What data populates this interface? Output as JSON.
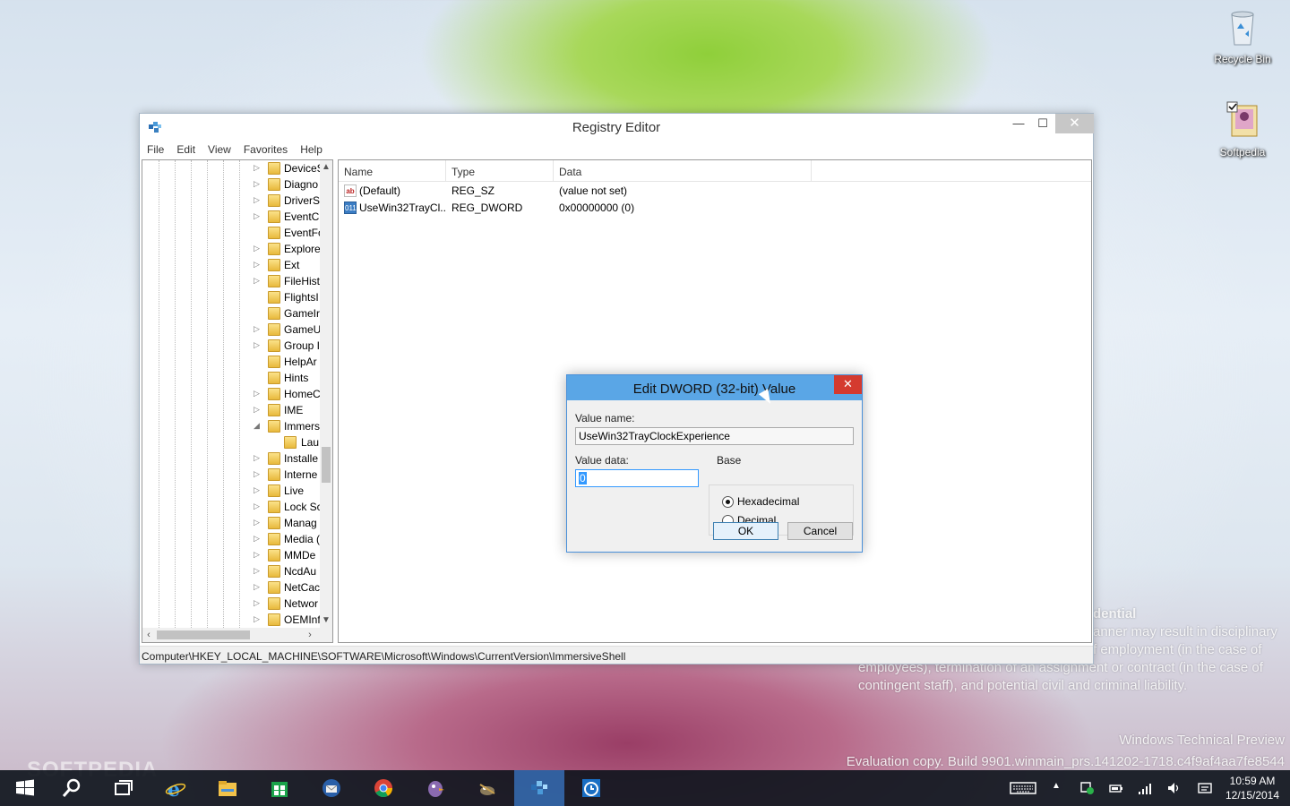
{
  "desktop": {
    "icons": [
      {
        "label": "Recycle Bin"
      },
      {
        "label": "Softpedia"
      }
    ],
    "notice": {
      "heading": "dential",
      "lines": [
        "anner may result in disciplinary",
        "f employment (in the case of",
        "employees), termination of an assignment or contract (in the case of",
        "contingent staff), and potential civil and criminal liability."
      ]
    },
    "build_lines": [
      "Windows Technical Preview",
      "Evaluation copy. Build 9901.winmain_prs.141202-1718.c4f9af4aa7fe8544"
    ],
    "watermark": "SOFTPEDIA"
  },
  "window": {
    "title": "Registry Editor",
    "controls": {
      "minimize": "—",
      "maximize": "☐",
      "close": "✕"
    },
    "menu": [
      "File",
      "Edit",
      "View",
      "Favorites",
      "Help"
    ],
    "tree": {
      "items": [
        {
          "label": "DeviceS",
          "expander": "▷"
        },
        {
          "label": "Diagno",
          "expander": "▷"
        },
        {
          "label": "DriverS",
          "expander": "▷"
        },
        {
          "label": "EventC",
          "expander": "▷"
        },
        {
          "label": "EventFo",
          "expander": ""
        },
        {
          "label": "Explore",
          "expander": "▷"
        },
        {
          "label": "Ext",
          "expander": "▷"
        },
        {
          "label": "FileHist",
          "expander": "▷"
        },
        {
          "label": "FlightsI",
          "expander": ""
        },
        {
          "label": "GameIr",
          "expander": ""
        },
        {
          "label": "GameU",
          "expander": "▷"
        },
        {
          "label": "Group I",
          "expander": "▷"
        },
        {
          "label": "HelpAr",
          "expander": ""
        },
        {
          "label": "Hints",
          "expander": ""
        },
        {
          "label": "HomeC",
          "expander": "▷"
        },
        {
          "label": "IME",
          "expander": "▷"
        },
        {
          "label": "Immers",
          "expander": "◢"
        },
        {
          "label": "Lau",
          "expander": "",
          "child": true
        },
        {
          "label": "Installe",
          "expander": "▷"
        },
        {
          "label": "Interne",
          "expander": "▷"
        },
        {
          "label": "Live",
          "expander": "▷"
        },
        {
          "label": "Lock Sc",
          "expander": "▷"
        },
        {
          "label": "Manag",
          "expander": "▷"
        },
        {
          "label": "Media (",
          "expander": "▷"
        },
        {
          "label": "MMDe",
          "expander": "▷"
        },
        {
          "label": "NcdAu",
          "expander": "▷"
        },
        {
          "label": "NetCac",
          "expander": "▷"
        },
        {
          "label": "Networ",
          "expander": "▷"
        },
        {
          "label": "OEMInf",
          "expander": "▷"
        }
      ]
    },
    "list": {
      "headers": {
        "name": "Name",
        "type": "Type",
        "data": "Data"
      },
      "rows": [
        {
          "icon": "ab",
          "name": "(Default)",
          "type": "REG_SZ",
          "data": "(value not set)"
        },
        {
          "icon": "011",
          "name": "UseWin32TrayCl...",
          "type": "REG_DWORD",
          "data": "0x00000000 (0)"
        }
      ]
    },
    "status_path": "Computer\\HKEY_LOCAL_MACHINE\\SOFTWARE\\Microsoft\\Windows\\CurrentVersion\\ImmersiveShell"
  },
  "dialog": {
    "title": "Edit DWORD (32-bit) Value",
    "close": "✕",
    "value_name_label": "Value name:",
    "value_name": "UseWin32TrayClockExperience",
    "value_data_label": "Value data:",
    "value_data": "0",
    "base_label": "Base",
    "base_options": [
      "Hexadecimal",
      "Decimal"
    ],
    "base_selected": "Hexadecimal",
    "ok_label": "OK",
    "cancel_label": "Cancel"
  },
  "taskbar": {
    "pinned": [
      "start-icon",
      "search-icon",
      "task-view-icon",
      "internet-explorer-icon",
      "file-explorer-icon",
      "store-icon",
      "thunderbird-icon",
      "chrome-icon",
      "pidgin-icon",
      "gimp-icon",
      "registry-editor-icon",
      "alarms-icon"
    ],
    "active": "registry-editor-icon",
    "clock": {
      "time": "10:59 AM",
      "date": "12/15/2014"
    }
  },
  "colors": {
    "dialog_title": "#5aa6e6",
    "dialog_close": "#d43a2f",
    "taskbar": "#10161e",
    "taskbar_active": "#3a78c8"
  }
}
